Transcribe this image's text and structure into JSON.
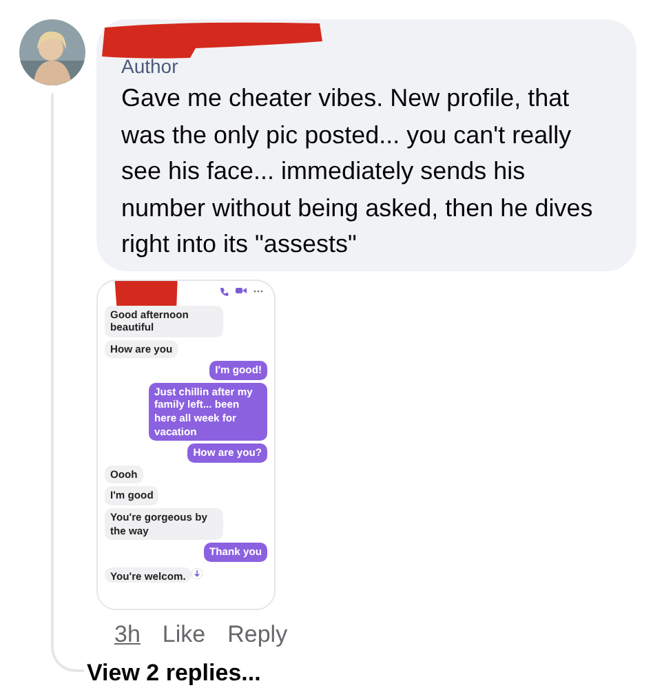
{
  "comment": {
    "badge": "Author",
    "text": "Gave me cheater vibes. New profile, that was the only pic posted... you can't really see his face... immediately sends his number without being asked, then he dives right into its \"assests\"",
    "attachment": {
      "messages": [
        {
          "kind": "incoming",
          "text": "Good afternoon beautiful"
        },
        {
          "kind": "incoming",
          "text": "How are you"
        },
        {
          "kind": "outgoing",
          "text": "I'm good!"
        },
        {
          "kind": "outgoing",
          "text": "Just chillin after my family left... been here all week for vacation"
        },
        {
          "kind": "outgoing",
          "text": "How are you?"
        },
        {
          "kind": "incoming",
          "text": "Oooh"
        },
        {
          "kind": "incoming",
          "text": "I'm good"
        },
        {
          "kind": "incoming",
          "text": "You're gorgeous by the way"
        },
        {
          "kind": "outgoing",
          "text": "Thank you"
        },
        {
          "kind": "incoming",
          "text": "You're welcom."
        }
      ]
    },
    "time": "3h",
    "actions": [
      "Like",
      "Reply"
    ]
  },
  "view_replies": "View 2 replies..."
}
